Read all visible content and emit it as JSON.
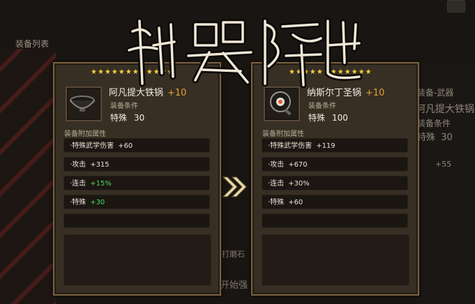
{
  "background": {
    "list_title": "装备列表",
    "right_panel": {
      "name": "阿凡提大铁锅",
      "type": "装备-武器",
      "req_label": "装备条件",
      "req_stat": "特殊",
      "req_value": "30",
      "attr_value": "+55"
    },
    "center_caption_top": "打磨石",
    "center_caption_bottom": "开始强"
  },
  "title_banner": {
    "text": "神器降世!"
  },
  "panels": {
    "left": {
      "stars": 12,
      "item_name": "阿凡提大铁锅",
      "item_plus": "+10",
      "icon": "iron-wok-icon",
      "req_label": "装备条件",
      "req_stat": "特殊",
      "req_value": "30",
      "attr_title": "装备附加属性",
      "attributes": [
        {
          "label": "·特殊武学伤害",
          "value": "+60",
          "highlight": false
        },
        {
          "label": "·攻击",
          "value": "+315",
          "highlight": false
        },
        {
          "label": "·连击",
          "value": "+15%",
          "highlight": true
        },
        {
          "label": "·特殊",
          "value": "+30",
          "highlight": true
        }
      ]
    },
    "right": {
      "stars": 12,
      "item_name": "纳斯尔丁圣锅",
      "item_plus": "+10",
      "icon": "frying-pan-icon",
      "req_label": "装备条件",
      "req_stat": "特殊",
      "req_value": "100",
      "attr_title": "装备附加属性",
      "attributes": [
        {
          "label": "·特殊武学伤害",
          "value": "+119",
          "highlight": false
        },
        {
          "label": "·攻击",
          "value": "+670",
          "highlight": false
        },
        {
          "label": "·连击",
          "value": "+30%",
          "highlight": false
        },
        {
          "label": "·特殊",
          "value": "+60",
          "highlight": false
        }
      ]
    }
  },
  "colors": {
    "panel_bg": "#372e24",
    "panel_border": "#7c6141",
    "star": "#f4d23d",
    "plus": "#e0a233",
    "green": "#4fd65a"
  }
}
